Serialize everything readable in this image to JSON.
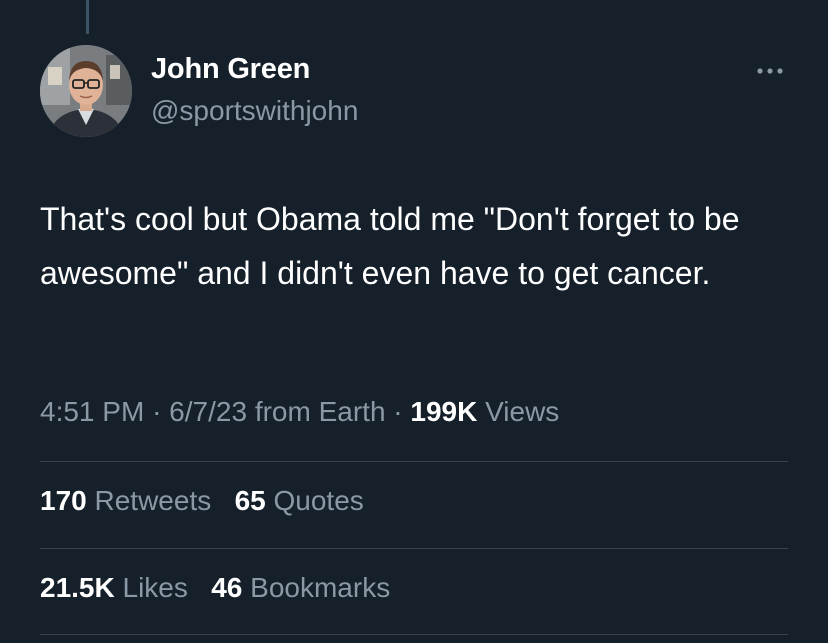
{
  "author": {
    "display_name": "John Green",
    "handle": "@sportswithjohn",
    "avatar_icon": "profile-photo"
  },
  "more_icon": "more-horizontal-icon",
  "tweet": {
    "text": "That's cool but Obama told me \"Don't forget to be awesome\" and I didn't even have to get cancer."
  },
  "meta": {
    "time": "4:51 PM",
    "separator": "·",
    "date": "6/7/23",
    "source": "from Earth",
    "views_count": "199K",
    "views_label": "Views"
  },
  "stats": {
    "retweets_count": "170",
    "retweets_label": "Retweets",
    "quotes_count": "65",
    "quotes_label": "Quotes",
    "likes_count": "21.5K",
    "likes_label": "Likes",
    "bookmarks_count": "46",
    "bookmarks_label": "Bookmarks"
  },
  "colors": {
    "background": "#15202b",
    "text_primary": "#ffffff",
    "text_secondary": "#8b98a5",
    "divider": "#38444d"
  }
}
